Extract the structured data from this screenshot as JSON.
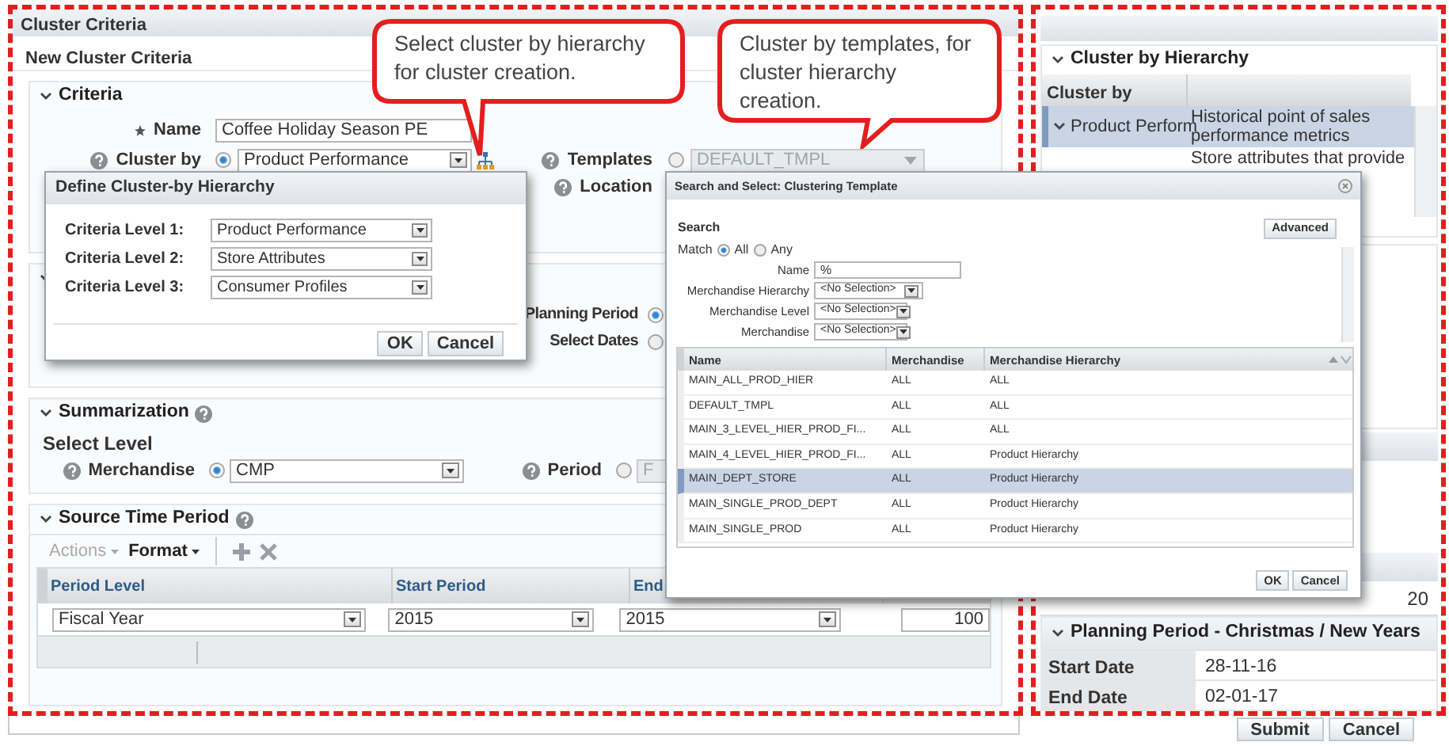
{
  "left_panel": {
    "title": "Cluster Criteria",
    "subtitle": "New Cluster Criteria",
    "criteria": {
      "header": "Criteria",
      "name": {
        "label": "Name",
        "required": true,
        "value": "Coffee Holiday Season PE"
      },
      "cluster_by": {
        "label": "Cluster by",
        "selected": true,
        "value": "Product Performance"
      },
      "templates": {
        "label": "Templates",
        "selected": false,
        "disabled": true,
        "value": "DEFAULT_TMPL"
      },
      "location": {
        "label": "Location"
      }
    },
    "planning_options": [
      {
        "label": "Planning Period",
        "selected": true
      },
      {
        "label": "Select Dates",
        "selected": false
      }
    ],
    "summarization": {
      "header": "Summarization",
      "select_level": "Select Level",
      "merchandise": {
        "label": "Merchandise",
        "selected": true,
        "value": "CMP"
      },
      "period": {
        "label": "Period",
        "selected": false,
        "value": "F"
      }
    },
    "source_time_period": {
      "header": "Source Time Period",
      "toolbar": [
        {
          "label": "Actions",
          "disabled": true
        },
        {
          "label": "Format",
          "disabled": false
        }
      ],
      "columns": [
        "Period Level",
        "Start Period",
        "End"
      ],
      "rows": [
        {
          "cells": [
            {
              "kind": "dropdown",
              "value": "Fiscal Year"
            },
            {
              "kind": "dropdown",
              "value": "2015"
            },
            {
              "kind": "dropdown",
              "value": "2015"
            },
            {
              "kind": "input",
              "value": "100"
            }
          ]
        }
      ]
    }
  },
  "right_panel": {
    "header": "Cluster by Hierarchy",
    "column": "Cluster by",
    "rows": [
      {
        "name": "Product Perform",
        "description": "Historical point of sales performance metrics",
        "selected": true
      },
      {
        "description": "Store attributes that provide",
        "selected": false
      }
    ],
    "value": "20",
    "planning_header": "Planning Period - Christmas / New Years",
    "dates": [
      {
        "label": "Start Date",
        "value": "28-11-16"
      },
      {
        "label": "End Date",
        "value": "02-01-17"
      }
    ],
    "buttons": [
      "Submit",
      "Cancel"
    ]
  },
  "define_dialog": {
    "title": "Define Cluster-by Hierarchy",
    "levels": [
      {
        "label": "Criteria Level 1:",
        "value": "Product Performance"
      },
      {
        "label": "Criteria Level 2:",
        "value": "Store Attributes"
      },
      {
        "label": "Criteria Level 3:",
        "value": "Consumer Profiles"
      }
    ],
    "buttons": [
      "OK",
      "Cancel"
    ]
  },
  "search_dialog": {
    "title": "Search and Select: Clustering Template",
    "search_label": "Search",
    "advanced": "Advanced",
    "match": {
      "label": "Match",
      "options": [
        {
          "label": "All",
          "selected": true
        },
        {
          "label": "Any",
          "selected": false
        }
      ]
    },
    "fields": [
      {
        "kind": "input",
        "label": "Name",
        "value": "%"
      },
      {
        "kind": "dropdown",
        "label": "Merchandise Hierarchy",
        "value": "<No Selection>"
      },
      {
        "kind": "dropdown",
        "label": "Merchandise Level",
        "value": "<No Selection>"
      },
      {
        "kind": "dropdown",
        "label": "Merchandise",
        "value": "<No Selection>"
      }
    ],
    "columns": [
      "Name",
      "Merchandise",
      "Merchandise Hierarchy"
    ],
    "rows": [
      {
        "cells": [
          "MAIN_ALL_PROD_HIER",
          "ALL",
          "ALL"
        ],
        "selected": false
      },
      {
        "cells": [
          "DEFAULT_TMPL",
          "ALL",
          "ALL"
        ],
        "selected": false
      },
      {
        "cells": [
          "MAIN_3_LEVEL_HIER_PROD_FI...",
          "ALL",
          "ALL"
        ],
        "selected": false
      },
      {
        "cells": [
          "MAIN_4_LEVEL_HIER_PROD_FI...",
          "ALL",
          "Product Hierarchy"
        ],
        "selected": false
      },
      {
        "cells": [
          "MAIN_DEPT_STORE",
          "ALL",
          "Product Hierarchy"
        ],
        "selected": true
      },
      {
        "cells": [
          "MAIN_SINGLE_PROD_DEPT",
          "ALL",
          "Product Hierarchy"
        ],
        "selected": false
      },
      {
        "cells": [
          "MAIN_SINGLE_PROD",
          "ALL",
          "Product Hierarchy"
        ],
        "selected": false
      }
    ],
    "buttons": [
      "OK",
      "Cancel"
    ]
  },
  "callouts": [
    {
      "text": "Select cluster by hierarchy for cluster creation."
    },
    {
      "text": "Cluster by templates, for cluster hierarchy creation."
    }
  ]
}
